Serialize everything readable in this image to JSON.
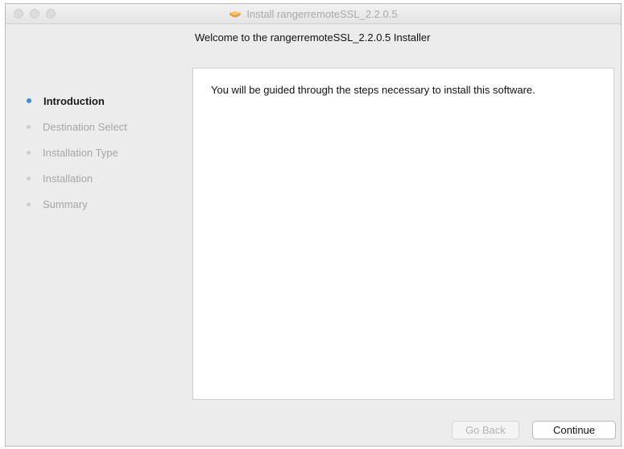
{
  "window": {
    "title": "Install rangerremoteSSL_2.2.0.5"
  },
  "header": {
    "title": "Welcome to the rangerremoteSSL_2.2.0.5 Installer"
  },
  "sidebar": {
    "steps": [
      {
        "label": "Introduction",
        "active": true
      },
      {
        "label": "Destination Select",
        "active": false
      },
      {
        "label": "Installation Type",
        "active": false
      },
      {
        "label": "Installation",
        "active": false
      },
      {
        "label": "Summary",
        "active": false
      }
    ]
  },
  "content": {
    "message": "You will be guided through the steps necessary to install this software."
  },
  "buttons": {
    "go_back": "Go Back",
    "continue": "Continue"
  },
  "colors": {
    "active_step_dot": "#3a8ce8",
    "window_background": "#ececec",
    "content_background": "#ffffff"
  },
  "icons": {
    "title_icon": "package-box-icon"
  }
}
